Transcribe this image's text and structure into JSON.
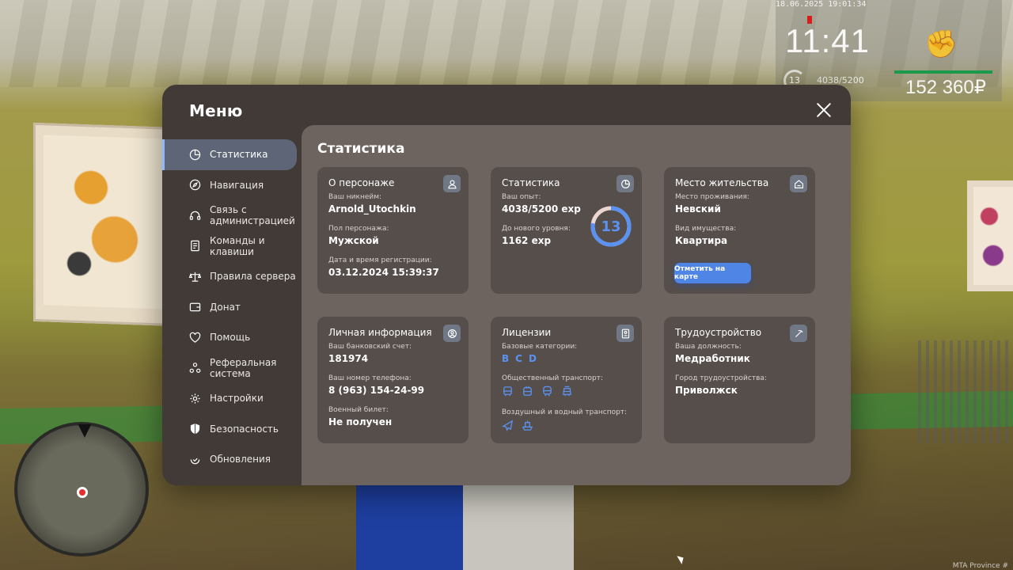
{
  "hud": {
    "datetime": "18.06.2025 19:01:34",
    "time": "11:41",
    "level": "13",
    "exp": "4038/5200",
    "money": "152 360₽"
  },
  "menu": {
    "title": "Меню",
    "nav": [
      {
        "label": "Статистика",
        "icon": "pie-chart-icon",
        "active": true
      },
      {
        "label": "Навигация",
        "icon": "compass-icon"
      },
      {
        "label": "Связь с администрацией",
        "icon": "headset-icon"
      },
      {
        "label": "Команды и клавиши",
        "icon": "document-icon"
      },
      {
        "label": "Правила сервера",
        "icon": "scales-icon"
      },
      {
        "label": "Донат",
        "icon": "wallet-icon"
      },
      {
        "label": "Помощь",
        "icon": "heart-handshake-icon"
      },
      {
        "label": "Реферальная система",
        "icon": "referral-icon"
      },
      {
        "label": "Настройки",
        "icon": "gear-icon"
      },
      {
        "label": "Безопасность",
        "icon": "shield-icon"
      },
      {
        "label": "Обновления",
        "icon": "refresh-check-icon"
      }
    ]
  },
  "content": {
    "title": "Статистика",
    "character": {
      "title": "О персонаже",
      "nickname_label": "Ваш никнейм:",
      "nickname": "Arnold_Utochkin",
      "gender_label": "Пол персонажа:",
      "gender": "Мужской",
      "reg_label": "Дата и время регистрации:",
      "reg": "03.12.2024 15:39:37"
    },
    "stats": {
      "title": "Статистика",
      "exp_label": "Ваш опыт:",
      "exp": "4038/5200 exp",
      "next_label": "До нового уровня:",
      "next": "1162 exp",
      "level": "13",
      "level_progress": 0.7765
    },
    "residence": {
      "title": "Место жительства",
      "place_label": "Место проживания:",
      "place": "Невский",
      "property_label": "Вид имущества:",
      "property": "Квартира",
      "map_button": "Отметить на карте"
    },
    "personal": {
      "title": "Личная информация",
      "bank_label": "Ваш банковский счет:",
      "bank": "181974",
      "phone_label": "Ваш номер телефона:",
      "phone": "8 (963) 154-24-99",
      "military_label": "Военный билет:",
      "military": "Не получен"
    },
    "licenses": {
      "title": "Лицензии",
      "basic_label": "Базовые категории:",
      "basic": [
        "B",
        "C",
        "D"
      ],
      "public_label": "Общественный транспорт:",
      "public_icons": [
        "bus-icon",
        "trolleybus-icon",
        "train-icon",
        "tram-icon"
      ],
      "air_water_label": "Воздушный и водный транспорт:",
      "air_water_icons": [
        "plane-icon",
        "ship-icon"
      ]
    },
    "employment": {
      "title": "Трудоустройство",
      "position_label": "Ваша должность:",
      "position": "Медработник",
      "city_label": "Город трудоустройства:",
      "city": "Приволжск"
    }
  },
  "watermark": "MTA Province #"
}
